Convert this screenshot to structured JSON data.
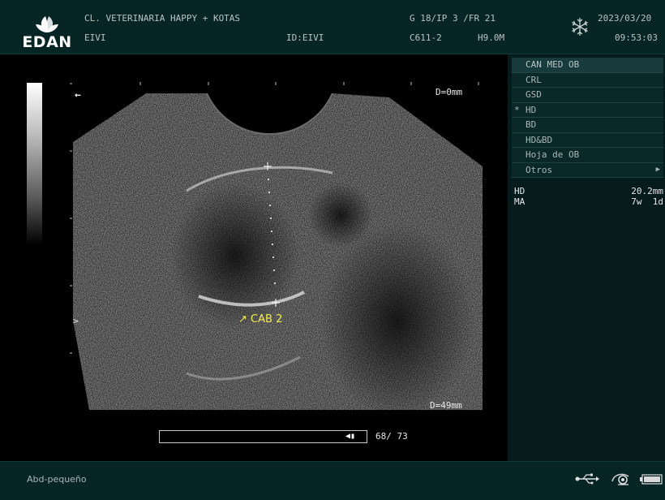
{
  "header": {
    "brand": "EDAN",
    "clinic": "CL. VETERINARIA HAPPY + KOTAS",
    "patient": "EIVI",
    "patient_id": "ID:EIVI",
    "gain_info": "G 18/IP 3 /FR 21",
    "probe": "C611-2",
    "frequency": "H9.0M",
    "date": "2023/03/20",
    "time": "09:53:03",
    "freeze_icon": "snowflake-icon"
  },
  "image": {
    "depth_top": "D=0mm",
    "depth_bottom": "D=49mm",
    "pointer_arrow": "←",
    "focus_marker": ">",
    "label": "CAB 2",
    "label_arrow": "↗"
  },
  "cine": {
    "counter": "68/ 73",
    "icon": "cine-review-icon"
  },
  "menu": {
    "title": "CAN MED OB",
    "items": [
      {
        "label": "CRL",
        "selected": false
      },
      {
        "label": "GSD",
        "selected": false
      },
      {
        "label": "HD",
        "selected": true,
        "marker": "*"
      },
      {
        "label": "BD",
        "selected": false
      },
      {
        "label": "HD&BD",
        "selected": false
      },
      {
        "label": "Hoja de OB",
        "selected": false
      },
      {
        "label": "Otros",
        "selected": false,
        "submenu_arrow": "▶"
      }
    ]
  },
  "measurements": [
    {
      "name": "HD",
      "value": "20.2mm"
    },
    {
      "name": "MA",
      "value": "7w  1d"
    }
  ],
  "footer": {
    "mode": "Abd-pequeño",
    "icons": [
      "usb-icon",
      "printer-icon",
      "battery-icon"
    ]
  },
  "colors": {
    "panel_bg": "#082526",
    "menu_bg": "#0b2829",
    "label_yellow": "#f2ea52"
  }
}
